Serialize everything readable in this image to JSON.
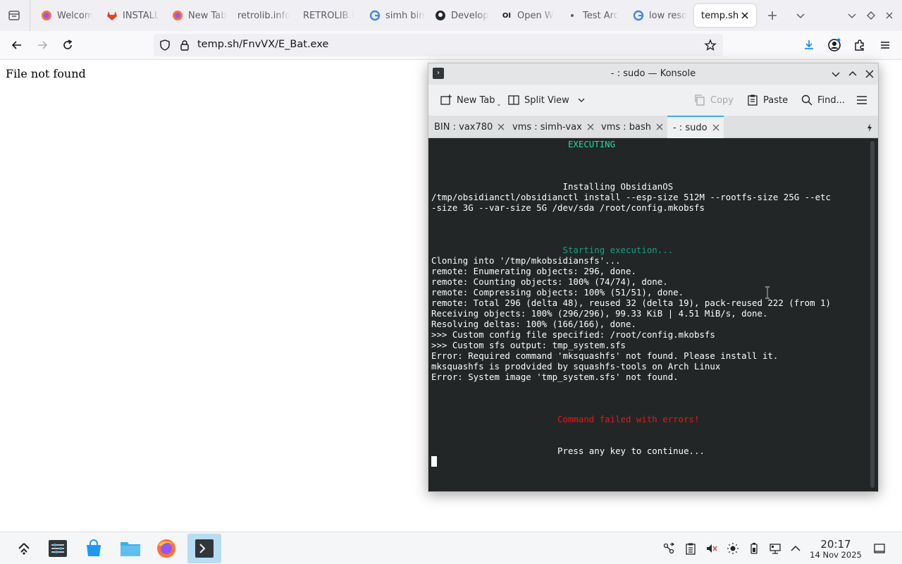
{
  "browser": {
    "tabs": [
      {
        "title": "Welcom",
        "favicon": "firefox-icon"
      },
      {
        "title": "INSTALL",
        "favicon": "gitlab-icon"
      },
      {
        "title": "New Tab",
        "favicon": "firefox-icon"
      },
      {
        "title": "retrolib.info",
        "favicon": "none"
      },
      {
        "title": "RETROLIB.I",
        "favicon": "none"
      },
      {
        "title": "simh bin",
        "favicon": "google-icon"
      },
      {
        "title": "Develop",
        "favicon": "github-icon"
      },
      {
        "title": "Open W",
        "favicon": "openwebui-icon"
      },
      {
        "title": "Test Arc",
        "favicon": "dot-icon"
      },
      {
        "title": "low reso",
        "favicon": "google-icon"
      },
      {
        "title": "temp.sh/",
        "favicon": "none",
        "active": true
      }
    ],
    "url": "temp.sh/FnvVX/E_Bat.exe"
  },
  "page": {
    "message": "File not found"
  },
  "konsole": {
    "title": "- : sudo — Konsole",
    "toolbar": {
      "new_tab": "New Tab",
      "split_view": "Split View",
      "copy": "Copy",
      "paste": "Paste",
      "find": "Find..."
    },
    "tabs": [
      {
        "label": "BIN : vax780"
      },
      {
        "label": "vms : simh-vax"
      },
      {
        "label": "vms : bash"
      },
      {
        "label": "- : sudo",
        "active": true
      }
    ],
    "terminal_lines": [
      {
        "text": "                          EXECUTING",
        "style": "green"
      },
      {
        "text": "",
        "style": ""
      },
      {
        "text": "",
        "style": ""
      },
      {
        "text": "",
        "style": ""
      },
      {
        "text": "                         Installing ObsidianOS",
        "style": ""
      },
      {
        "text": "/tmp/obsidianctl/obsidianctl install --esp-size 512M --rootfs-size 25G --etc",
        "style": ""
      },
      {
        "text": "-size 3G --var-size 5G /dev/sda /root/config.mkobsfs",
        "style": ""
      },
      {
        "text": "",
        "style": ""
      },
      {
        "text": "",
        "style": ""
      },
      {
        "text": "",
        "style": ""
      },
      {
        "text": "                         Starting execution...",
        "style": "teal"
      },
      {
        "text": "Cloning into '/tmp/mkobsidiansfs'...",
        "style": ""
      },
      {
        "text": "remote: Enumerating objects: 296, done.",
        "style": ""
      },
      {
        "text": "remote: Counting objects: 100% (74/74), done.",
        "style": ""
      },
      {
        "text": "remote: Compressing objects: 100% (51/51), done.",
        "style": ""
      },
      {
        "text": "remote: Total 296 (delta 48), reused 32 (delta 19), pack-reused 222 (from 1)",
        "style": ""
      },
      {
        "text": "Receiving objects: 100% (296/296), 99.33 KiB | 4.51 MiB/s, done.",
        "style": ""
      },
      {
        "text": "Resolving deltas: 100% (166/166), done.",
        "style": ""
      },
      {
        "text": ">>> Custom config file specified: /root/config.mkobsfs",
        "style": ""
      },
      {
        "text": ">>> Custom sfs output: tmp_system.sfs",
        "style": ""
      },
      {
        "text": "Error: Required command 'mksquashfs' not found. Please install it.",
        "style": ""
      },
      {
        "text": "mksquashfs is prodvided by squashfs-tools on Arch Linux",
        "style": ""
      },
      {
        "text": "Error: System image 'tmp_system.sfs' not found.",
        "style": ""
      },
      {
        "text": "",
        "style": ""
      },
      {
        "text": "",
        "style": ""
      },
      {
        "text": "",
        "style": ""
      },
      {
        "text": "                        Command failed with errors!",
        "style": "red"
      },
      {
        "text": "",
        "style": ""
      },
      {
        "text": "",
        "style": ""
      },
      {
        "text": "                        Press any key to continue...",
        "style": ""
      }
    ]
  },
  "taskbar": {
    "time": "20:17",
    "date": "14 Nov 2025"
  },
  "colors": {
    "accent": "#3daee9",
    "terminal_bg": "#232627",
    "terminal_green": "#1cdc9a",
    "terminal_teal": "#16a085",
    "terminal_red": "#ed1515"
  }
}
